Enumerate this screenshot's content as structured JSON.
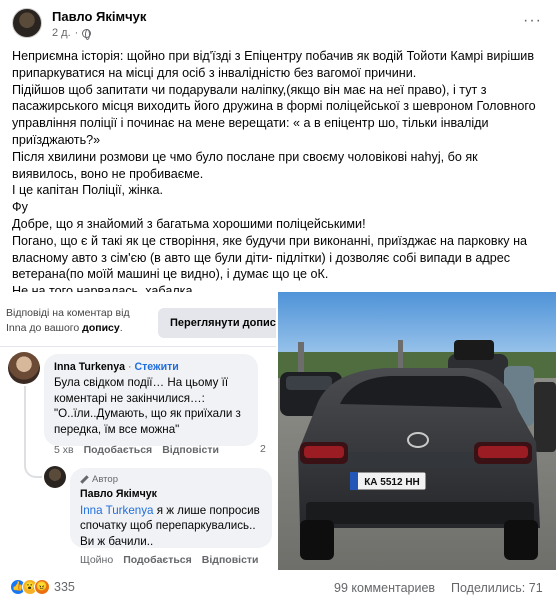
{
  "post": {
    "author": "Павло Якімчук",
    "time": "2 д.",
    "more": "···",
    "paragraphs": [
      "Неприємна історія: щойно при від'їзді з Епіцентру побачив як водій Тойоти Камрі вирішив припаркуватися на місці для осіб з інвалідністю без вагомої причини.",
      "Підійшов щоб запитати чи подарували наліпку,(якщо він має на неї право), і тут з пасажирського місця виходить його дружина в формі поліцейської з шевроном Головного управління поліції і починає на мене верещати: « а в епіцентр шо, тільки інваліди приїзджають?»",
      "Після хвилини розмови це чмо було послане при своєму чоловікові наhуj, бо як виявилось, воно не пробиваєме.",
      "І це капітан Поліції, жінка.",
      "Фу",
      "Добре, що я знайомий з багатьма хорошими поліцейськими!",
      "Погано, що є й такі як це створіння, яке будучи при виконанні, приїзджає на парковку на власному авто з сім'єю (в авто ще були діти- підлітки) і дозволяє собі випади в адрес ветерана(по моїй машині це видно), і думає що це оК.",
      "Не на того нарвалась, хабалка.."
    ]
  },
  "reply_note": {
    "line1": "Відповіді на коментар від",
    "line2_name": "Inna",
    "line2_mid": " до вашого ",
    "line2_bold": "допису",
    "line2_end": ".",
    "view_button": "Переглянути допис"
  },
  "comment1": {
    "name": "Inna Turkenya",
    "sep": " · ",
    "follow": "Стежити",
    "text": "Була свідком події… На цьому її коментарі не закінчилися…: \"О..їли..Думають, що як приїхали з передка, їм все можна\"",
    "time": "5 хв",
    "like": "Подобається",
    "reply": "Відповісти",
    "reply_count": "2"
  },
  "comment2": {
    "badge": "Автор",
    "name": "Павло Якімчук",
    "mention": "Inna Turkenya",
    "text": " я ж лише попросив спочатку щоб перепаркувались.. Ви ж бачили..",
    "time": "Щойно",
    "like": "Подобається",
    "reply": "Відповісти"
  },
  "photo": {
    "plate": "КА 5512 НН"
  },
  "footer": {
    "reactions_count": "335",
    "comments": "99 комментариев",
    "shares": "Поделились: 71"
  },
  "colors": {
    "link": "#216fdb",
    "like": "#1877f2",
    "muted": "#65676b",
    "bubble": "#f0f2f5"
  }
}
